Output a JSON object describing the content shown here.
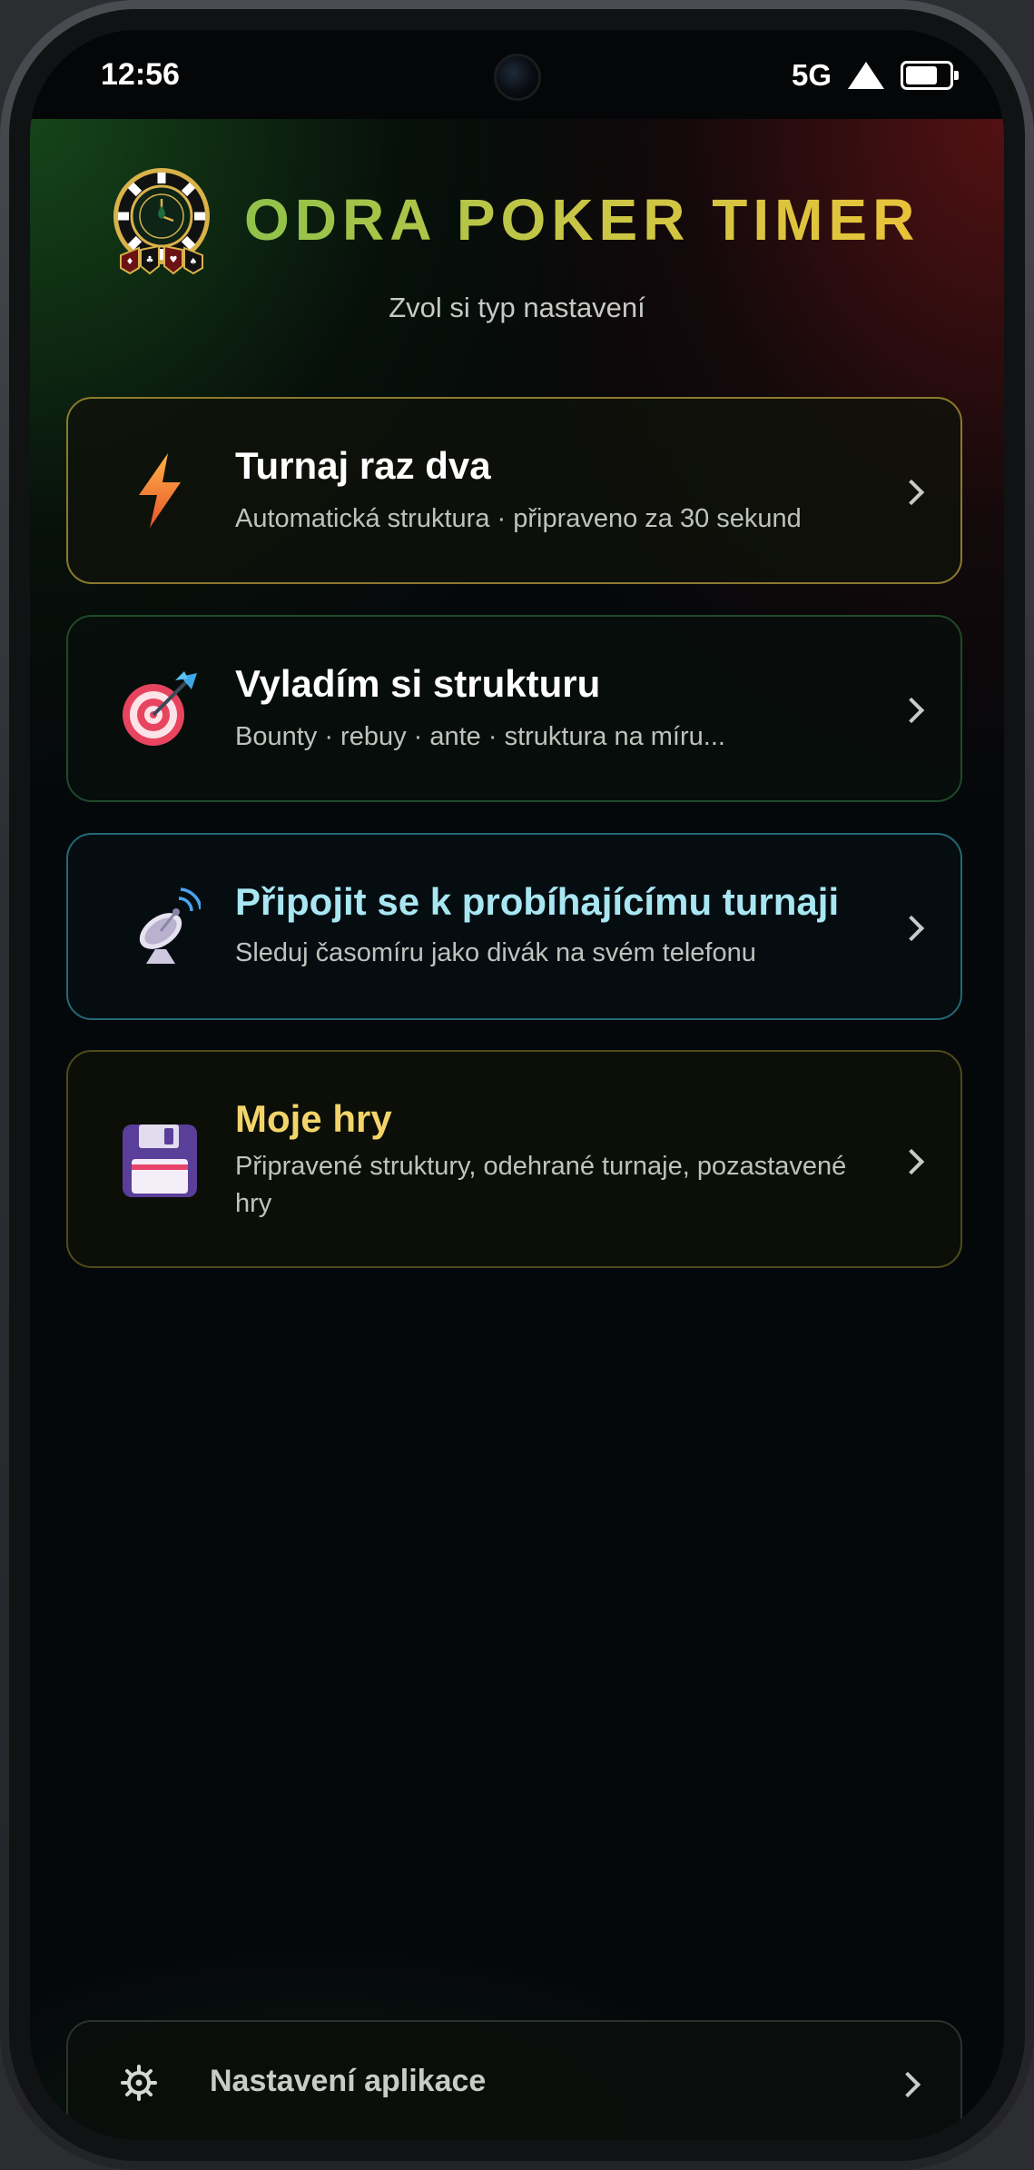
{
  "status_bar": {
    "time": "12:56",
    "network": "5G",
    "icons": [
      "signal-icon",
      "battery-icon"
    ]
  },
  "header": {
    "logo_icon": "poker-chip-timer-logo",
    "title": "ODRA POKER TIMER",
    "subtitle": "Zvol si typ nastavení",
    "title_gradient": [
      "#8fc24a",
      "#e9c33a"
    ]
  },
  "options": [
    {
      "title": "Turnaj raz dva",
      "description": "Automatická struktura · připraveno za 30 sekund",
      "icon": "lightning-icon",
      "accent": "#8b7a2c"
    },
    {
      "title": "Vyladím si strukturu",
      "description": "Bounty · rebuy · ante · struktura na míru...",
      "icon": "dart-target-icon",
      "accent": "#1f4a2a"
    },
    {
      "title": "Připojit se k probíhajícímu turnaji",
      "description": "Sleduj časomíru jako divák na svém telefonu",
      "icon": "satellite-dish-icon",
      "accent": "#236874"
    },
    {
      "title": "Moje hry",
      "description": "Připravené struktury, odehrané turnaje, pozastavené hry",
      "icon": "floppy-disk-icon",
      "accent": "#504a1a"
    }
  ],
  "footer": {
    "settings_label": "Nastavení aplikace",
    "icon": "gear-icon"
  }
}
